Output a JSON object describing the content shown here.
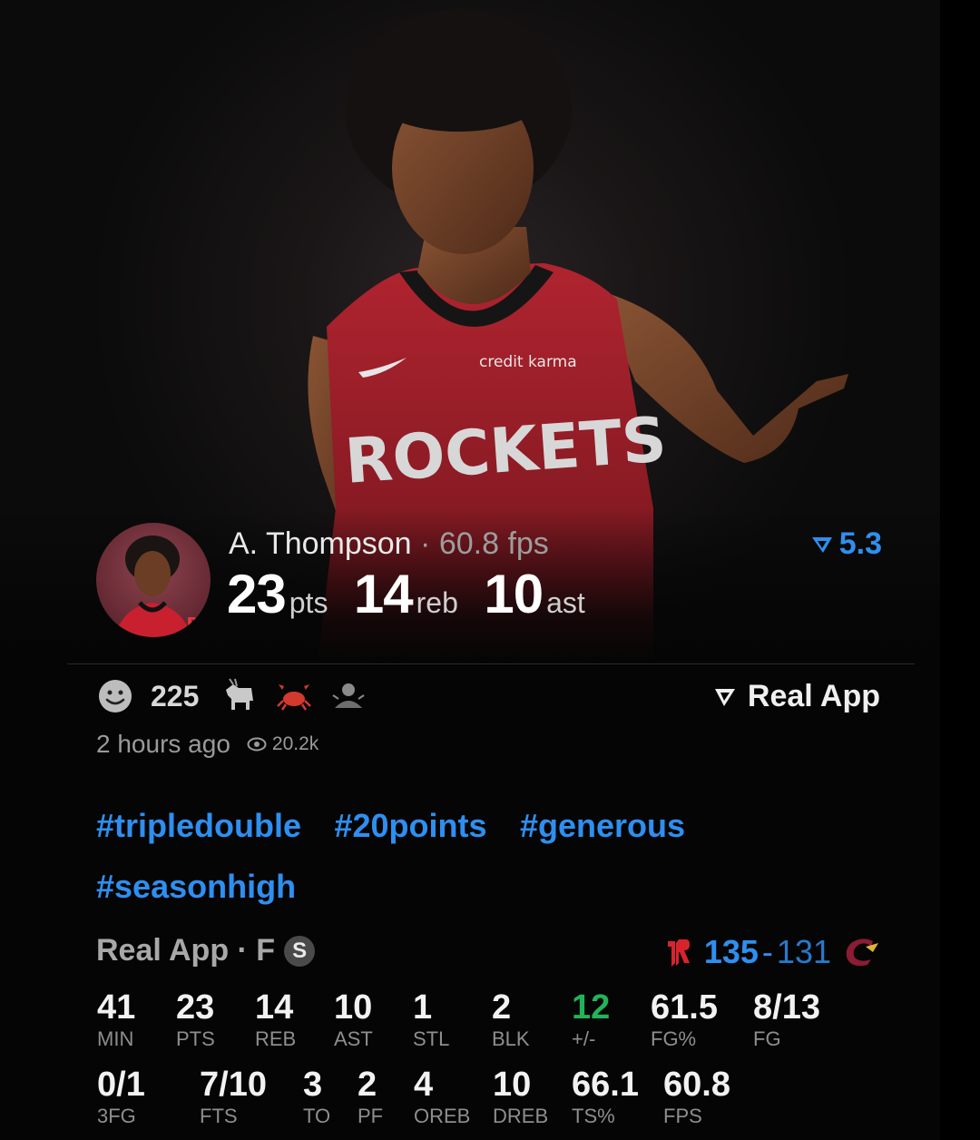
{
  "player": {
    "name": "A. Thompson",
    "fps_text": "60.8 fps",
    "stat_line": [
      {
        "value": "23",
        "unit": "pts"
      },
      {
        "value": "14",
        "unit": "reb"
      },
      {
        "value": "10",
        "unit": "ast"
      }
    ],
    "rating": "5.3",
    "jersey_text": "ROCKETS",
    "jersey_sponsor": "credit karma"
  },
  "reactions": {
    "count": "225",
    "icons": [
      "smiley-icon",
      "goat-icon",
      "crab-icon",
      "cook-icon"
    ]
  },
  "source_link": "Real App",
  "meta": {
    "time": "2 hours ago",
    "views": "20.2k"
  },
  "hashtags": [
    "#tripledouble",
    "#20points",
    "#generous",
    "#seasonhigh"
  ],
  "box": {
    "header": "Real App · F",
    "badge": "S",
    "home_score": "135",
    "separator": "-",
    "away_score": "131",
    "row1": [
      {
        "value": "41",
        "label": "MIN"
      },
      {
        "value": "23",
        "label": "PTS"
      },
      {
        "value": "14",
        "label": "REB"
      },
      {
        "value": "10",
        "label": "AST"
      },
      {
        "value": "1",
        "label": "STL"
      },
      {
        "value": "2",
        "label": "BLK"
      },
      {
        "value": "12",
        "label": "+/-"
      },
      {
        "value": "61.5",
        "label": "FG%"
      },
      {
        "value": "8/13",
        "label": "FG"
      }
    ],
    "row2": [
      {
        "value": "0/1",
        "label": "3FG"
      },
      {
        "value": "7/10",
        "label": "FTS"
      },
      {
        "value": "3",
        "label": "TO"
      },
      {
        "value": "2",
        "label": "PF"
      },
      {
        "value": "4",
        "label": "OREB"
      },
      {
        "value": "10",
        "label": "DREB"
      },
      {
        "value": "66.1",
        "label": "TS%"
      },
      {
        "value": "60.8",
        "label": "FPS"
      }
    ]
  },
  "colors": {
    "accent_blue": "#2e8ff0",
    "positive_green": "#22b35a",
    "rockets_red": "#c8202f",
    "cavs_wine": "#7a1f34"
  }
}
